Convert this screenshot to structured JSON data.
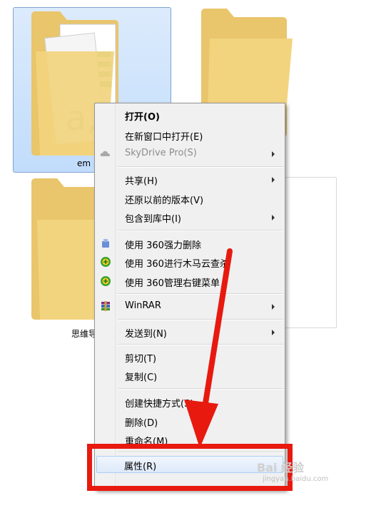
{
  "folders": [
    {
      "name": "em"
    },
    {
      "name": "思维导"
    }
  ],
  "menu": {
    "items": [
      {
        "label": "打开(O)",
        "bold": true
      },
      {
        "label": "在新窗口中打开(E)"
      },
      {
        "label": "SkyDrive Pro(S)",
        "disabled": true,
        "submenu": true,
        "icon": "cloud-icon"
      },
      {
        "label": "共享(H)",
        "submenu": true
      },
      {
        "label": "还原以前的版本(V)"
      },
      {
        "label": "包含到库中(I)",
        "submenu": true
      },
      {
        "label": "使用 360强力删除",
        "icon": "360-delete-icon"
      },
      {
        "label": "使用 360进行木马云查杀",
        "icon": "360-scan-icon"
      },
      {
        "label": "使用 360管理右键菜单",
        "icon": "360-manage-icon"
      },
      {
        "label": "WinRAR",
        "submenu": true,
        "icon": "winrar-icon"
      },
      {
        "label": "发送到(N)",
        "submenu": true
      },
      {
        "label": "剪切(T)"
      },
      {
        "label": "复制(C)"
      },
      {
        "label": "创建快捷方式(S)"
      },
      {
        "label": "删除(D)"
      },
      {
        "label": "重命名(M)"
      },
      {
        "label": "属性(R)",
        "highlighted": true
      }
    ]
  },
  "watermark": {
    "brand": "Bai 经验",
    "site": "jingyan.baidu.com"
  },
  "colors": {
    "highlight_box": "#e8190f",
    "arrow": "#e8190f",
    "menu_bg": "#f0f0f0"
  }
}
